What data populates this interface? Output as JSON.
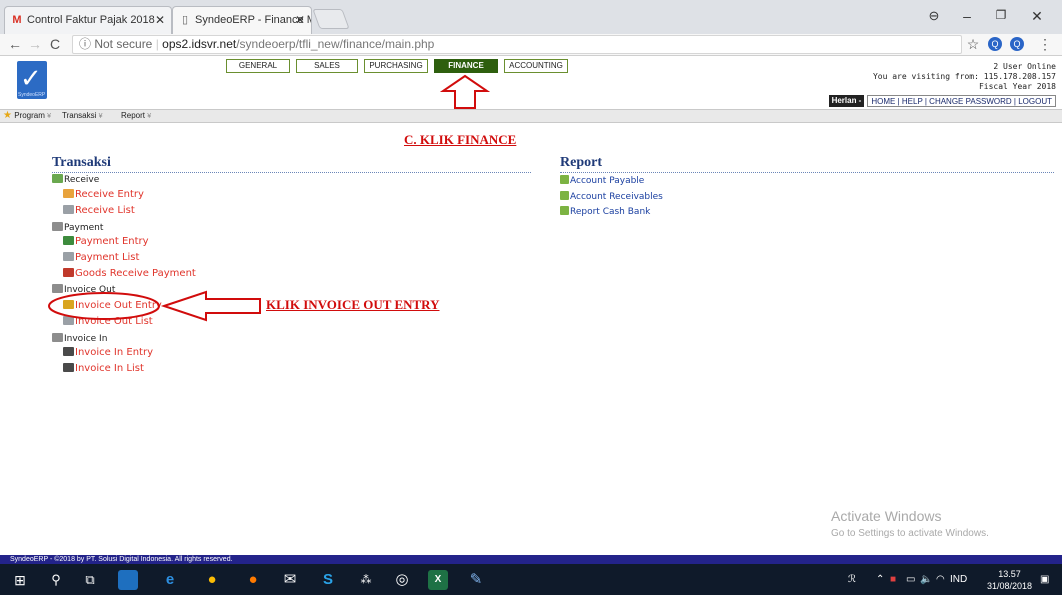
{
  "browser": {
    "tabs": [
      {
        "label": "Control Faktur Pajak 2018",
        "favicon": "gmail-icon"
      },
      {
        "label": "SyndeoERP - Finance Mo",
        "favicon": "page-icon"
      }
    ],
    "tab_close": "✕",
    "url_secure": "ⓘ Not secure",
    "url_host": "ops2.idsvr.net",
    "url_path": "/syndeoerp/tfli_new/finance/main.php"
  },
  "app": {
    "logo_text": "SyndeoERP",
    "modules": [
      "GENERAL",
      "SALES",
      "PURCHASING",
      "FINANCE",
      "ACCOUNTING"
    ],
    "active_module": "FINANCE",
    "users_online": "2 User Online",
    "visiting_from": "You are visiting from: 115.178.208.157",
    "fiscal_year": "Fiscal Year 2018",
    "user_name": "Herlan -",
    "user_links": "HOME | HELP | CHANGE PASSWORD | LOGOUT"
  },
  "menubar": {
    "items": [
      {
        "label": "Program",
        "arrow": "¥"
      },
      {
        "label": "Transaksi",
        "arrow": "¥"
      },
      {
        "label": "Report",
        "arrow": "¥"
      }
    ]
  },
  "annotations": {
    "finance_hint": "C. KLIK FINANCE",
    "invoice_hint": "KLIK INVOICE OUT ENTRY"
  },
  "transaksi": {
    "title": "Transaksi",
    "groups": [
      {
        "label": "Receive",
        "links": [
          "Receive Entry",
          "Receive List"
        ]
      },
      {
        "label": "Payment",
        "links": [
          "Payment Entry",
          "Payment List",
          "Goods Receive Payment"
        ]
      },
      {
        "label": "Invoice Out",
        "links": [
          "Invoice Out Entry",
          "Invoice Out List"
        ]
      },
      {
        "label": "Invoice In",
        "links": [
          "Invoice In Entry",
          "Invoice In List"
        ]
      }
    ]
  },
  "report": {
    "title": "Report",
    "links": [
      "Account Payable",
      "Account Receivables",
      "Report Cash Bank"
    ]
  },
  "watermark": {
    "line1": "Activate Windows",
    "line2": "Go to Settings to activate Windows."
  },
  "footer": "SyndeoERP - ©2018 by PT. Solusi Digital Indonesia. All rights reserved.",
  "taskbar": {
    "time": "13.57",
    "date": "31/08/2018",
    "language": "IND"
  },
  "colors": {
    "active_tab": "#2e5f0e",
    "link_red": "#e0342b",
    "title_blue": "#1f3a78",
    "annotation_red": "#d10c0c"
  }
}
